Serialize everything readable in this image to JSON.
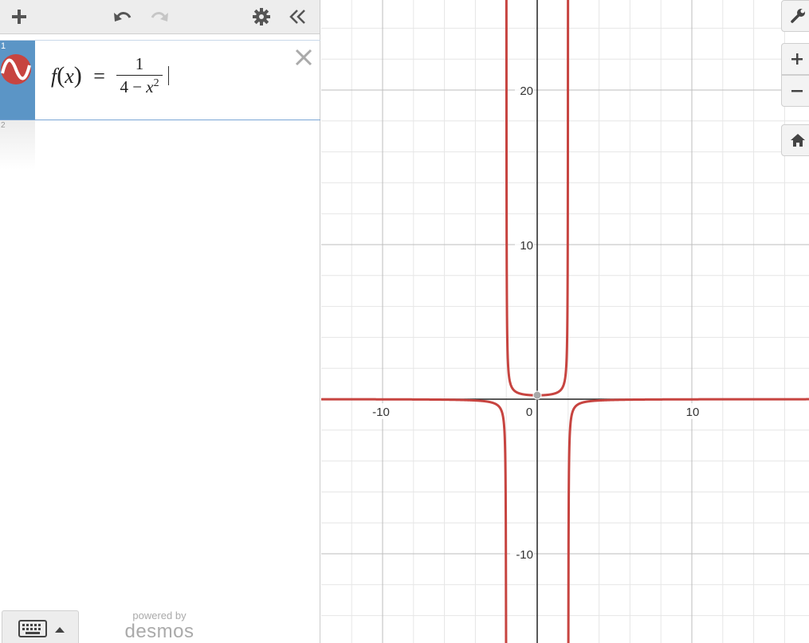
{
  "toolbar": {
    "add_icon": "plus-icon",
    "undo_icon": "undo-icon",
    "redo_icon": "redo-icon",
    "settings_icon": "gear-icon",
    "collapse_icon": "double-chevron-left-icon"
  },
  "expressions": [
    {
      "index": "1",
      "lhs": "f",
      "var": "x",
      "eq": "=",
      "numerator": "1",
      "denominator_a": "4 − ",
      "denominator_b": "x",
      "exponent": "2",
      "color": "#c74440"
    },
    {
      "index": "2"
    }
  ],
  "footer": {
    "powered_by": "powered by",
    "brand": "desmos"
  },
  "graph": {
    "x_ticks": [
      "-10",
      "0",
      "10"
    ],
    "y_ticks": [
      "20",
      "10",
      "-10"
    ],
    "curve_color": "#c74440",
    "controls": [
      "wrench-icon",
      "zoom-in-icon",
      "zoom-out-icon",
      "home-icon"
    ]
  }
}
